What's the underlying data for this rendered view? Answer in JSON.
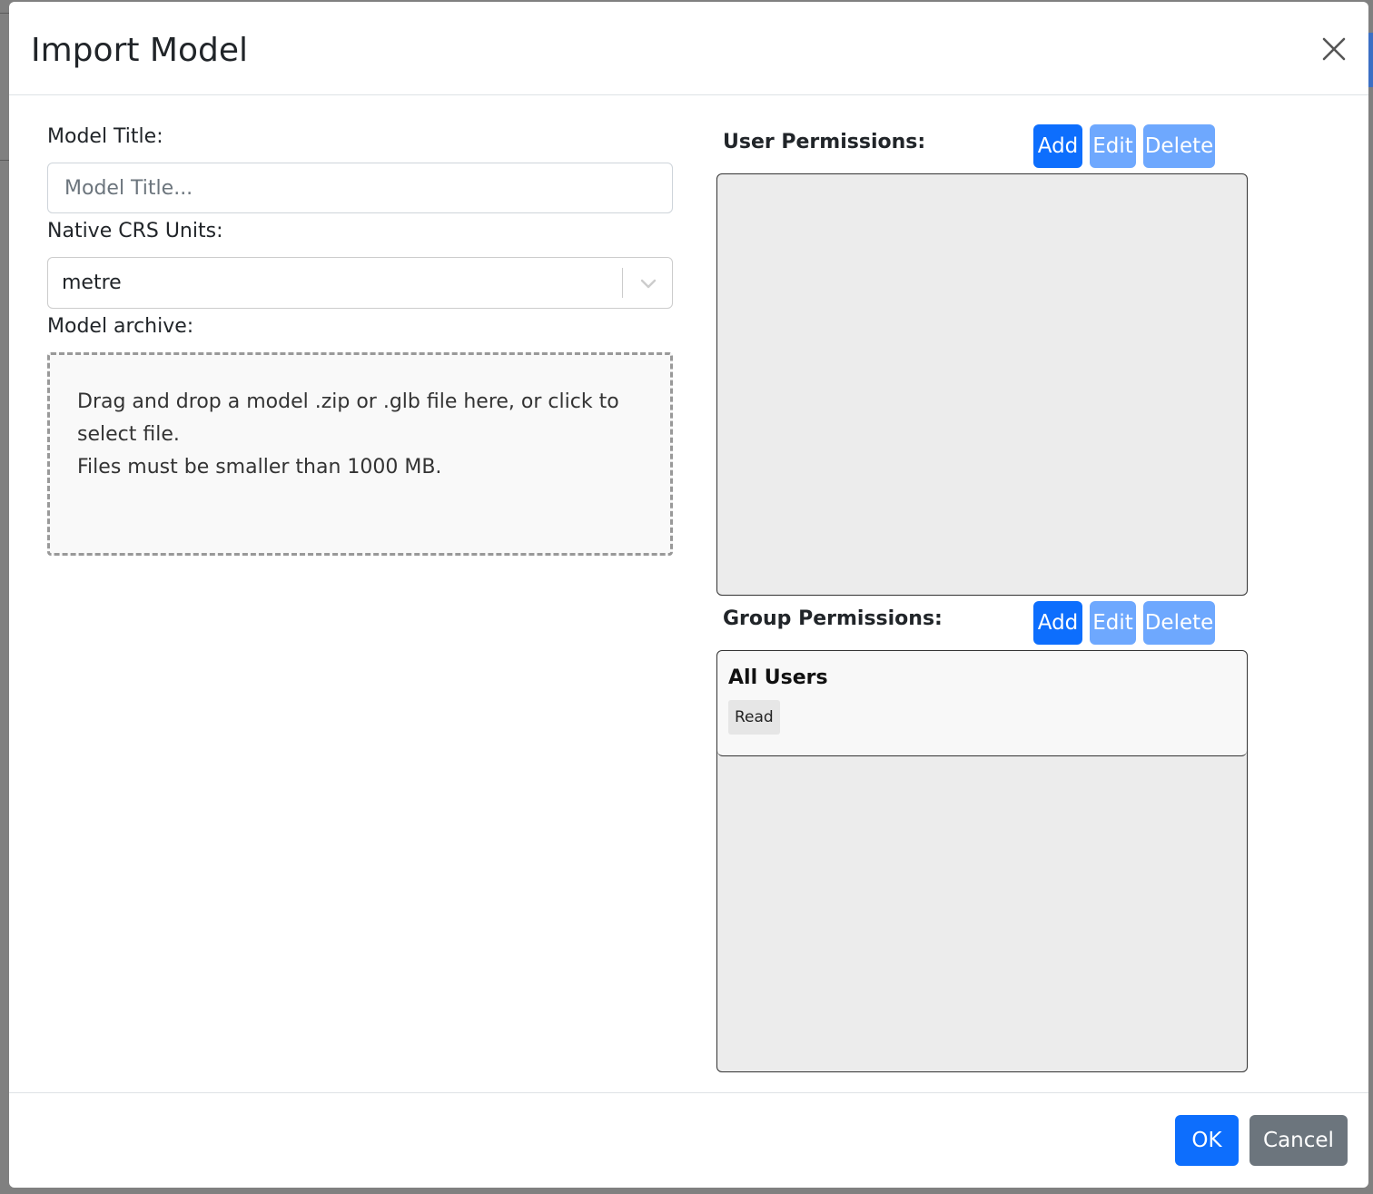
{
  "dialog": {
    "title": "Import Model",
    "close_label": "×"
  },
  "form": {
    "model_title": {
      "label": "Model Title:",
      "placeholder": "Model Title...",
      "value": ""
    },
    "crs_units": {
      "label": "Native CRS Units:",
      "selected": "metre"
    },
    "archive": {
      "label": "Model archive:",
      "instructions": "Drag and drop a model .zip or .glb file here, or click to select file.",
      "size_limit": "Files must be smaller than 1000 MB."
    }
  },
  "user_permissions": {
    "label": "User Permissions:",
    "add_label": "Add",
    "edit_label": "Edit",
    "delete_label": "Delete",
    "items": []
  },
  "group_permissions": {
    "label": "Group Permissions:",
    "add_label": "Add",
    "edit_label": "Edit",
    "delete_label": "Delete",
    "items": [
      {
        "name": "All Users",
        "permission": "Read"
      }
    ]
  },
  "footer": {
    "ok_label": "OK",
    "cancel_label": "Cancel"
  },
  "colors": {
    "primary": "#0d6efd",
    "primary_disabled": "#6ea8fe",
    "secondary": "#6c757d",
    "list_background": "#ececec"
  }
}
